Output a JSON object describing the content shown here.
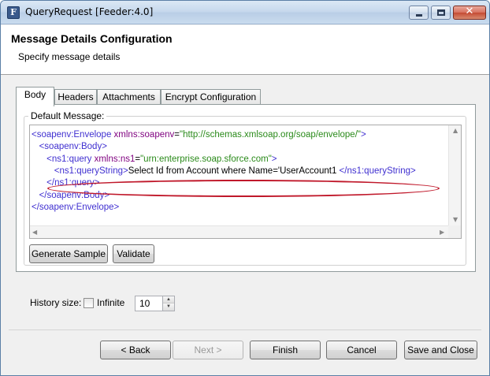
{
  "window": {
    "title": "QueryRequest [Feeder:4.0]",
    "app_icon_letter": "F",
    "close_glyph": "✕"
  },
  "header": {
    "title": "Message Details Configuration",
    "subtitle": "Specify message details"
  },
  "tabs": [
    {
      "label": "Body",
      "active": true
    },
    {
      "label": "Headers",
      "active": false
    },
    {
      "label": "Attachments",
      "active": false
    },
    {
      "label": "Encrypt Configuration",
      "active": false
    }
  ],
  "body_panel": {
    "group_label": "Default Message:",
    "code_lines": [
      {
        "indent": "",
        "open": "<soapenv:Envelope ",
        "attr": "xmlns:soapenv",
        "eq": "=",
        "value": "\"http://schemas.xmlsoap.org/soap/envelope/\"",
        "close": ">"
      },
      {
        "indent": "   ",
        "open": "<soapenv:Body>",
        "attr": "",
        "eq": "",
        "value": "",
        "close": ""
      },
      {
        "indent": "      ",
        "open": "<ns1:query ",
        "attr": "xmlns:ns1",
        "eq": "=",
        "value": "\"urn:enterprise.soap.sforce.com\"",
        "close": ">"
      },
      {
        "indent": "         ",
        "open": "<ns1:queryString>",
        "text": "Select Id from Account where Name='UserAccount1 ",
        "close_tag": "</ns1:queryString>"
      },
      {
        "indent": "      ",
        "open": "</ns1:query>",
        "attr": "",
        "eq": "",
        "value": "",
        "close": ""
      },
      {
        "indent": "   ",
        "open": "</soapenv:Body>",
        "attr": "",
        "eq": "",
        "value": "",
        "close": ""
      },
      {
        "indent": "",
        "open": "</soapenv:Envelope>",
        "attr": "",
        "eq": "",
        "value": "",
        "close": ""
      }
    ],
    "generate_sample_label": "Generate Sample",
    "validate_label": "Validate"
  },
  "history": {
    "label": "History size:",
    "infinite_label": "Infinite",
    "infinite_checked": false,
    "value": "10"
  },
  "footer": {
    "back_label": "< Back",
    "next_label": "Next >",
    "finish_label": "Finish",
    "cancel_label": "Cancel",
    "save_close_label": "Save and Close",
    "next_enabled": false
  },
  "colors": {
    "tag": "#3f2fd0",
    "attr": "#7f007f",
    "value": "#2a8a1a",
    "highlight": "#c0182a"
  }
}
